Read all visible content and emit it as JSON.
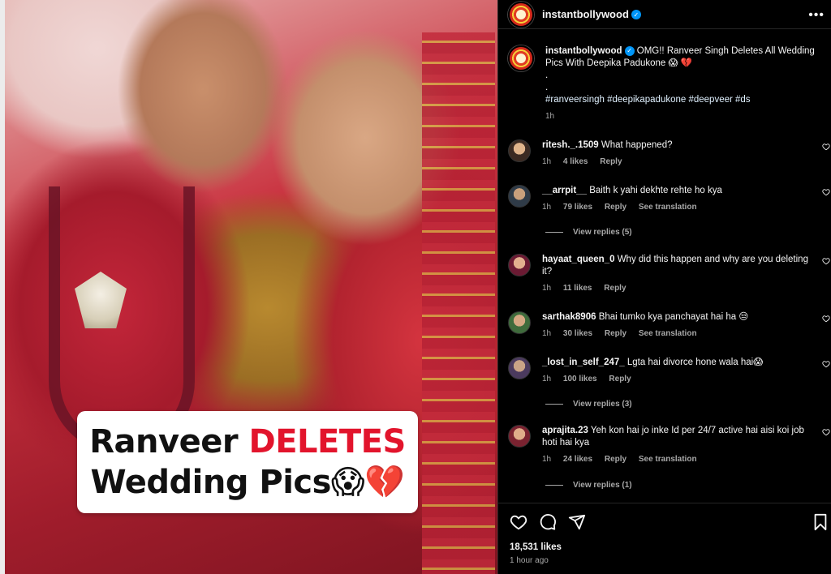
{
  "post": {
    "username": "instantbollywood",
    "verified_mark": "✓",
    "more_label": "•••",
    "image_caption": {
      "line1_prefix": "Ranveer ",
      "line1_highlight": "DELETES",
      "line2": "Wedding Pics😱💔"
    }
  },
  "caption": {
    "username": "instantbollywood",
    "text": "OMG!! Ranveer Singh Deletes All Wedding Pics With Deepika Padukone 😱 💔",
    "dot1": ".",
    "dot2": ".",
    "hashtags": "#ranveersingh #deepikapadukone #deepveer #ds",
    "time": "1h"
  },
  "comments": [
    {
      "username": "ritesh._.1509",
      "text": "What happened?",
      "time": "1h",
      "likes": "4 likes",
      "reply": "Reply",
      "see_translation": "",
      "view_replies": "",
      "avatar_color": "#c79a6e"
    },
    {
      "username": "__arrpit__",
      "text": "Baith k yahi dekhte rehte ho kya",
      "time": "1h",
      "likes": "79 likes",
      "reply": "Reply",
      "see_translation": "See translation",
      "view_replies": "View replies (5)",
      "avatar_color": "#5a6b7c"
    },
    {
      "username": "hayaat_queen_0",
      "text": "Why did this happen and why are you deleting it?",
      "time": "1h",
      "likes": "11 likes",
      "reply": "Reply",
      "see_translation": "",
      "view_replies": "",
      "avatar_color": "#b8526b"
    },
    {
      "username": "sarthak8906",
      "text": "Bhai tumko kya panchayat hai ha 😒",
      "time": "1h",
      "likes": "30 likes",
      "reply": "Reply",
      "see_translation": "See translation",
      "view_replies": "",
      "avatar_color": "#5b8a5e"
    },
    {
      "username": "_lost_in_self_247_",
      "text": "Lgta hai divorce hone wala hai😱",
      "time": "1h",
      "likes": "100 likes",
      "reply": "Reply",
      "see_translation": "",
      "view_replies": "View replies (3)",
      "avatar_color": "#7a5d8e"
    },
    {
      "username": "aprajita.23",
      "text": "Yeh kon hai jo inke Id per 24/7 active hai aisi koi job hoti hai kya",
      "time": "1h",
      "likes": "24 likes",
      "reply": "Reply",
      "see_translation": "See translation",
      "view_replies": "View replies (1)",
      "avatar_color": "#a8434f"
    }
  ],
  "footer": {
    "likes": "18,531 likes",
    "time_ago": "1 hour ago"
  }
}
